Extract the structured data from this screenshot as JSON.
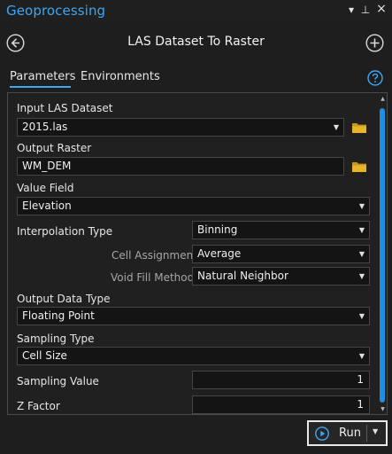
{
  "pane": {
    "title": "Geoprocessing",
    "controls": {
      "menu": "▾",
      "pin": "⊥",
      "close": "×"
    }
  },
  "tool": {
    "title": "LAS Dataset To Raster"
  },
  "tabs": {
    "parameters": "Parameters",
    "environments": "Environments"
  },
  "params": {
    "input_las_label": "Input LAS Dataset",
    "input_las_value": "2015.las",
    "output_raster_label": "Output Raster",
    "output_raster_value": "WM_DEM",
    "value_field_label": "Value Field",
    "value_field_value": "Elevation",
    "interp_label": "Interpolation Type",
    "interp_value": "Binning",
    "cell_assign_label": "Cell Assignment",
    "cell_assign_value": "Average",
    "void_fill_label": "Void Fill Method",
    "void_fill_value": "Natural Neighbor",
    "output_dtype_label": "Output Data Type",
    "output_dtype_value": "Floating Point",
    "sampling_type_label": "Sampling Type",
    "sampling_type_value": "Cell Size",
    "sampling_value_label": "Sampling Value",
    "sampling_value_value": "1",
    "z_factor_label": "Z Factor",
    "z_factor_value": "1"
  },
  "run": {
    "label": "Run"
  },
  "colors": {
    "accent": "#3ea6f3",
    "scrollbar": "#1d8fe0",
    "folder": "#e8b52a",
    "background": "#1e1e1e"
  },
  "icons": [
    "back-arrow-icon",
    "add-icon",
    "help-icon",
    "folder-icon",
    "chevron-down-icon",
    "play-icon"
  ]
}
